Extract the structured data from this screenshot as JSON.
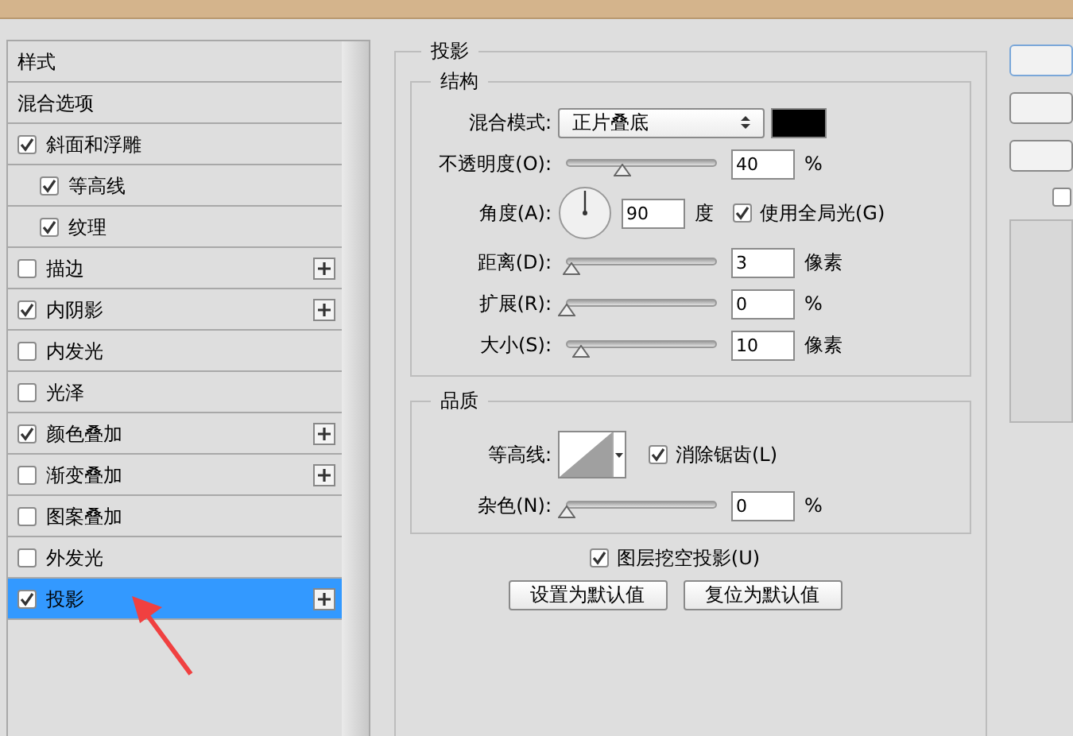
{
  "sidebar": {
    "items": [
      {
        "label": "样式",
        "kind": "header",
        "selected": false
      },
      {
        "label": "混合选项",
        "kind": "header",
        "selected": false
      },
      {
        "label": "斜面和浮雕",
        "kind": "check",
        "checked": true,
        "selected": false,
        "addable": false,
        "children": [
          {
            "label": "等高线",
            "checked": true,
            "selected": false
          },
          {
            "label": "纹理",
            "checked": true,
            "selected": false
          }
        ]
      },
      {
        "label": "描边",
        "kind": "check",
        "checked": false,
        "selected": false,
        "addable": true
      },
      {
        "label": "内阴影",
        "kind": "check",
        "checked": true,
        "selected": false,
        "addable": true
      },
      {
        "label": "内发光",
        "kind": "check",
        "checked": false,
        "selected": false,
        "addable": false
      },
      {
        "label": "光泽",
        "kind": "check",
        "checked": false,
        "selected": false,
        "addable": false
      },
      {
        "label": "颜色叠加",
        "kind": "check",
        "checked": true,
        "selected": false,
        "addable": true
      },
      {
        "label": "渐变叠加",
        "kind": "check",
        "checked": false,
        "selected": false,
        "addable": true
      },
      {
        "label": "图案叠加",
        "kind": "check",
        "checked": false,
        "selected": false,
        "addable": false
      },
      {
        "label": "外发光",
        "kind": "check",
        "checked": false,
        "selected": false,
        "addable": false
      },
      {
        "label": "投影",
        "kind": "check",
        "checked": true,
        "selected": true,
        "addable": true
      }
    ]
  },
  "panel": {
    "title": "投影",
    "structure": {
      "title": "结构",
      "rows": [
        {
          "kind": "select",
          "label": "混合模式:",
          "value": "正片叠底"
        },
        {
          "kind": "slider",
          "label": "不透明度(O):",
          "level": 0.39,
          "value": "40",
          "unit": "%"
        },
        {
          "kind": "angle",
          "label": "角度(A):",
          "value": "90",
          "unit": "度",
          "checkbox": {
            "label": "使用全局光(G)",
            "checked": true
          }
        },
        {
          "kind": "slider",
          "label": "距离(D):",
          "level": 0.03,
          "value": "3",
          "unit": "像素"
        },
        {
          "kind": "slider",
          "label": "扩展(R):",
          "level": 0.0,
          "value": "0",
          "unit": "%"
        },
        {
          "kind": "slider",
          "label": "大小(S):",
          "level": 0.1,
          "value": "10",
          "unit": "像素"
        }
      ]
    },
    "quality": {
      "title": "品质",
      "rows": [
        {
          "kind": "contour",
          "label": "等高线:",
          "checkbox": {
            "label": "消除锯齿(L)",
            "checked": true
          }
        },
        {
          "kind": "slider",
          "label": "杂色(N):",
          "level": 0.0,
          "value": "0",
          "unit": "%"
        }
      ]
    },
    "knockout": {
      "label": "图层挖空投影(U)",
      "checked": true
    },
    "buttons": [
      "设置为默认值",
      "复位为默认值"
    ]
  },
  "preview_checkbox": {
    "checked": false
  }
}
